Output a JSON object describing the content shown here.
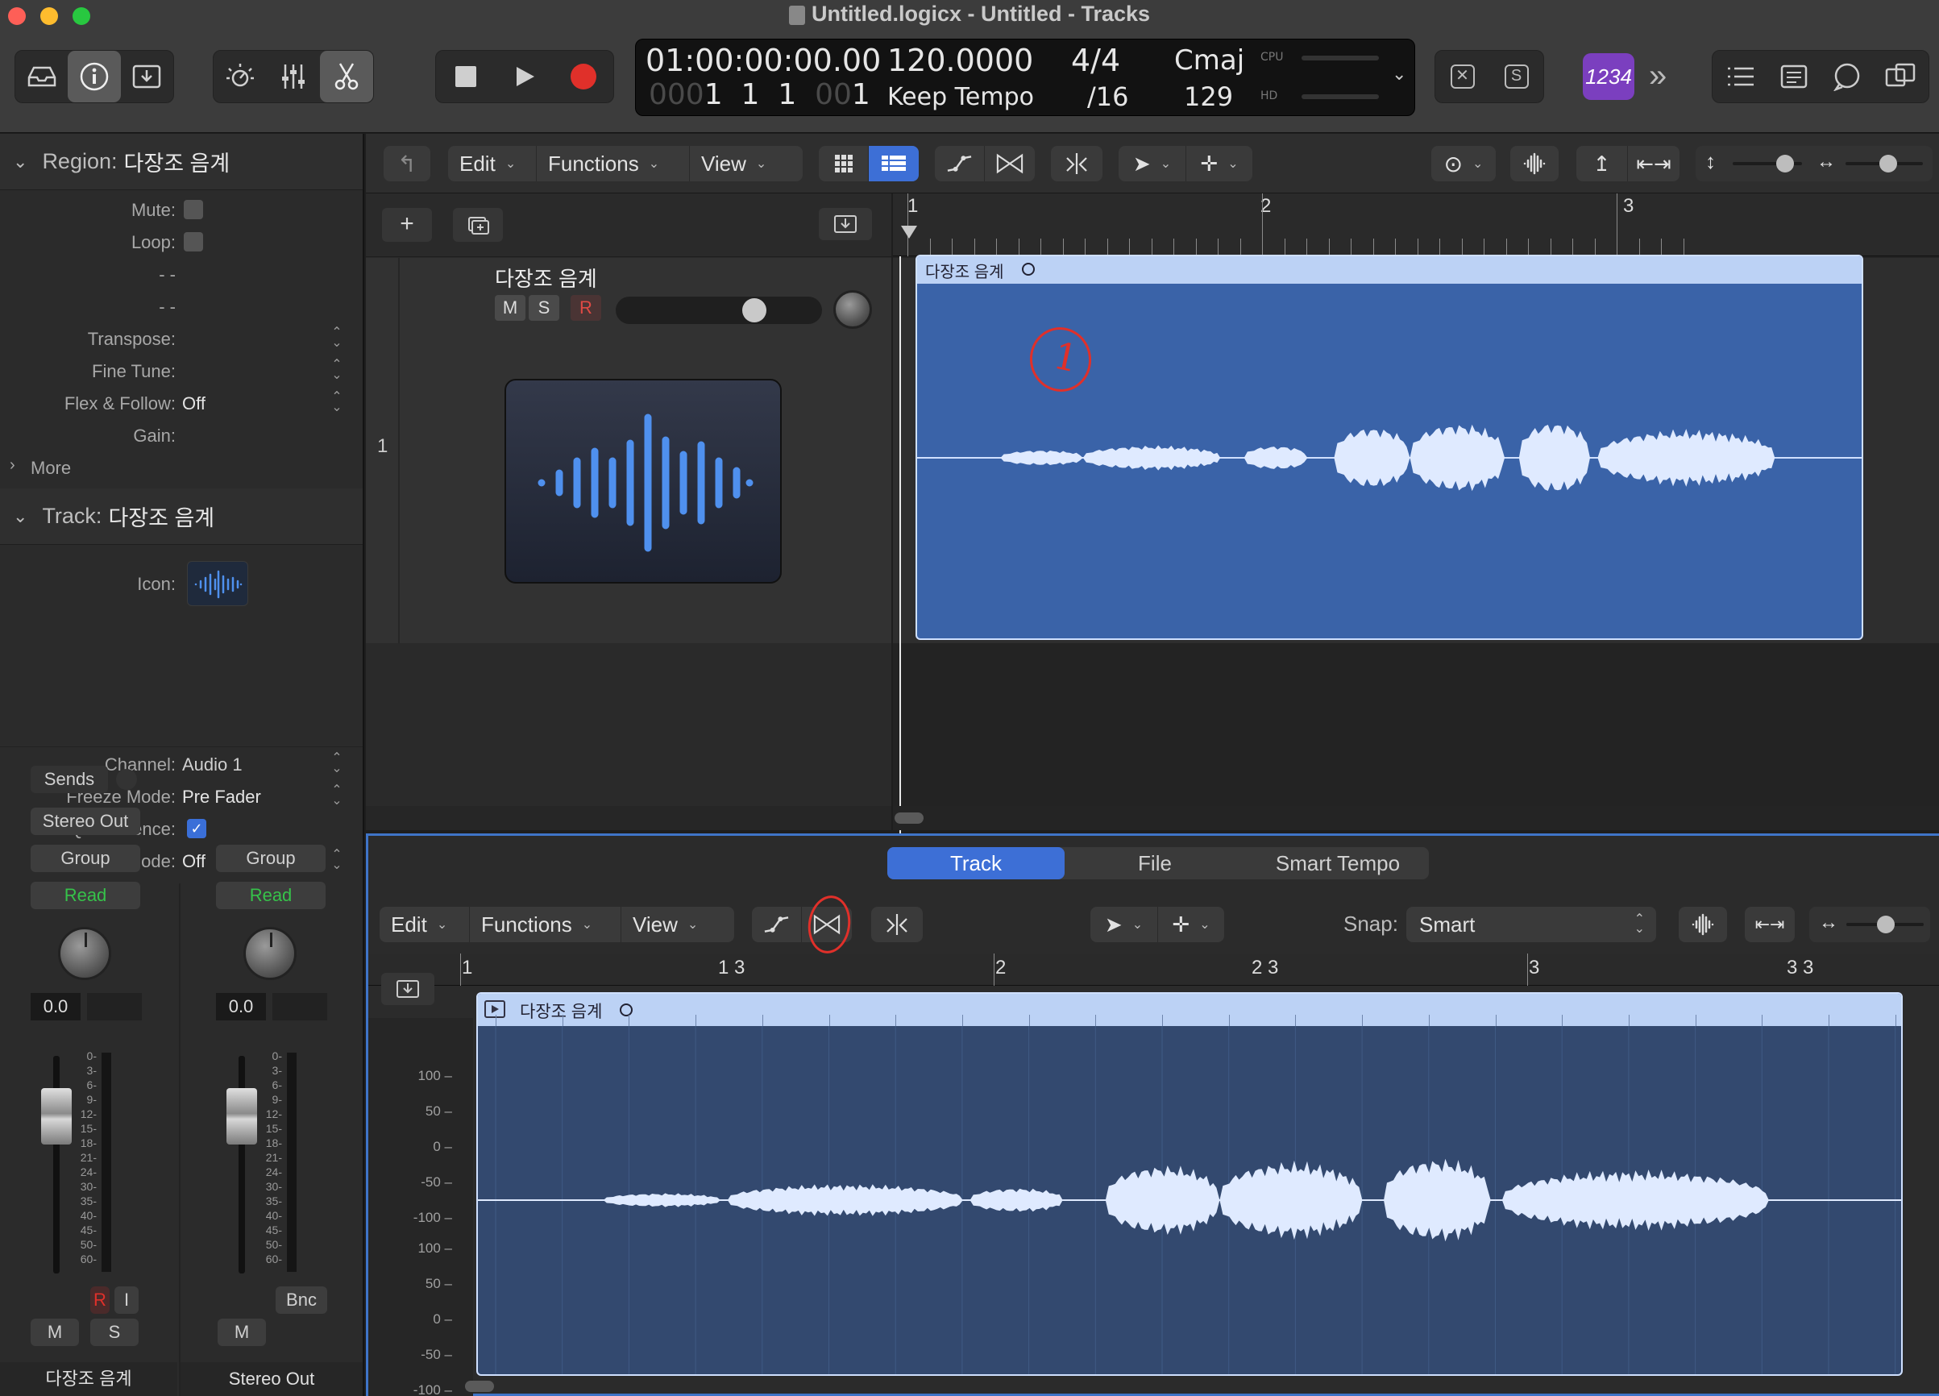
{
  "window": {
    "title": "Untitled.logicx - Untitled - Tracks",
    "traffic_lights": {
      "close": "#fe5f57",
      "minimize": "#febc2e",
      "zoom": "#28c840"
    }
  },
  "control_bar": {
    "icons": [
      "library-icon",
      "inspector-icon",
      "downloads-icon",
      "smart-controls-icon",
      "mixer-icon",
      "editors-scissors-icon"
    ],
    "transport": [
      "stop-icon",
      "play-icon",
      "record-icon"
    ],
    "lcd": {
      "time": "01:00:00:00.00",
      "bars_dim1": "000",
      "bars1": "1",
      "bars2": "1",
      "bars3": "1",
      "bars_dim2": "00",
      "bars4": "1",
      "tempo": "120.0000",
      "tempo_mode": "Keep Tempo",
      "signature_top": "4/4",
      "signature_bottom": "/16",
      "key": "Cmaj",
      "key_number": "129",
      "cpu_label": "CPU",
      "hd_label": "HD"
    },
    "count_in": "1234",
    "right_icons": [
      "list-editors-icon",
      "notepad-icon",
      "loop-browser-icon",
      "browsers-icon"
    ],
    "accent_purple": "#7b3fbf",
    "record_red": "#e0302a"
  },
  "inspector": {
    "region_header_label": "Region:",
    "region_name": "다장조 음계",
    "region_rows": [
      {
        "label": "Mute:",
        "type": "checkbox",
        "checked": false
      },
      {
        "label": "Loop:",
        "type": "checkbox",
        "checked": false
      },
      {
        "label": "- -",
        "type": "text"
      },
      {
        "label": "- -",
        "type": "text"
      },
      {
        "label": "Transpose:",
        "value": ""
      },
      {
        "label": "Fine Tune:",
        "value": ""
      },
      {
        "label": "Flex & Follow:",
        "value": "Off"
      },
      {
        "label": "Gain:",
        "value": ""
      }
    ],
    "more_label": "More",
    "track_header_label": "Track:",
    "track_name": "다장조 음계",
    "track_rows": {
      "icon_label": "Icon:",
      "channel_label": "Channel:",
      "channel_value": "Audio 1",
      "freeze_label": "Freeze Mode:",
      "freeze_value": "Pre Fader",
      "qref_label": "Q-Reference:",
      "qref_checked": true,
      "flex_label": "Flex Mode:",
      "flex_value": "Off"
    },
    "strip1": {
      "sends": "Sends",
      "output": "Stereo Out",
      "group": "Group",
      "automation": "Read",
      "volume": "0.0",
      "r_label": "R",
      "i_label": "I",
      "m_label": "M",
      "s_label": "S",
      "name": "다장조 음계"
    },
    "strip2": {
      "group": "Group",
      "automation": "Read",
      "volume": "0.0",
      "bnc_label": "Bnc",
      "m_label": "M",
      "name": "Stereo Out"
    },
    "meter_scale": [
      "0",
      "3",
      "6",
      "9",
      "12",
      "15",
      "18",
      "21",
      "24",
      "30",
      "35",
      "40",
      "45",
      "50",
      "60"
    ]
  },
  "tracks_toolbar": {
    "back_icon": "catch-up-icon",
    "edit": "Edit",
    "functions": "Functions",
    "view": "View",
    "icons": [
      "grid-view-icon",
      "list-view-icon",
      "automation-icon",
      "flex-icon",
      "split-icon",
      "pointer-tool-icon",
      "marquee-tool-icon",
      "waveform-zoom-icon",
      "vertical-zoom-icon",
      "fit-icon"
    ]
  },
  "track_list": {
    "add_icon": "add-track-icon",
    "duplicate_icon": "duplicate-track-icon",
    "catch_icon": "download-icon",
    "track_number": "1",
    "track_name": "다장조 음계",
    "mute": "M",
    "solo": "S",
    "record": "R",
    "volume_fraction": 0.7
  },
  "main_ruler": [
    "1",
    "2",
    "3"
  ],
  "main_region": {
    "name": "다장조 음계",
    "annotation": "1",
    "color": "#3a63a8",
    "header_color": "#bcd2f5"
  },
  "editor": {
    "tabs": [
      "Track",
      "File",
      "Smart Tempo"
    ],
    "active_tab": "Track",
    "edit": "Edit",
    "functions": "Functions",
    "view": "View",
    "snap_label": "Snap:",
    "snap_value": "Smart",
    "ruler": [
      "1",
      "1 3",
      "2",
      "2 3",
      "3",
      "3 3"
    ],
    "region_name": "다장조 음계",
    "y_labels_top": [
      "100",
      "50",
      "0",
      "-50",
      "-100"
    ],
    "y_labels_bottom": [
      "100",
      "50",
      "0",
      "-50",
      "-100"
    ],
    "annotation_circle_color": "#e0302a"
  }
}
